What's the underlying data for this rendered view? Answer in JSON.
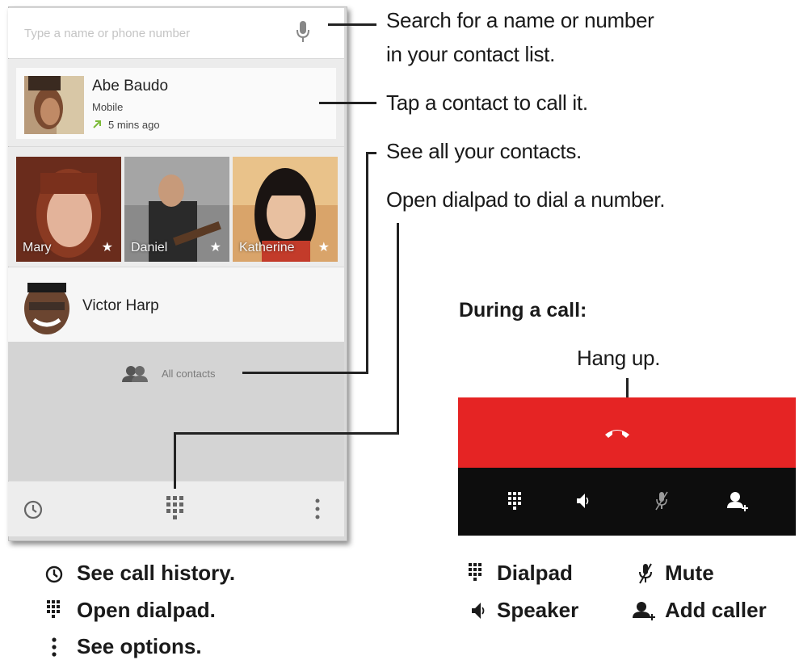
{
  "search": {
    "placeholder": "Type a name or phone number",
    "mic_icon": "microphone-icon"
  },
  "recent": {
    "name": "Abe Baudo",
    "type": "Mobile",
    "time": "5 mins ago",
    "arrow_icon": "outgoing-call-arrow-icon",
    "arrow_color": "#7dbb3a"
  },
  "favorites": [
    {
      "name": "Mary"
    },
    {
      "name": "Daniel"
    },
    {
      "name": "Katherine"
    }
  ],
  "contact": {
    "name": "Victor Harp"
  },
  "all_contacts": {
    "label": "All contacts",
    "icon": "contacts-icon"
  },
  "bottom_bar": {
    "history_icon": "clock-icon",
    "dialpad_icon": "dialpad-icon",
    "options_icon": "overflow-menu-icon"
  },
  "callouts": {
    "search_line1": "Search for a name or number",
    "search_line2": "in your contact list.",
    "tap_contact": "Tap a contact to call it.",
    "see_all": "See all your contacts.",
    "open_dialpad": "Open dialpad to dial a number."
  },
  "during_call": {
    "heading": "During a call:",
    "hang_up": "Hang up.",
    "red_color": "#e52424"
  },
  "legend_phone": {
    "history": "See call history.",
    "dialpad": "Open dialpad.",
    "options": "See options."
  },
  "legend_call": {
    "dialpad": "Dialpad",
    "mute": "Mute",
    "speaker": "Speaker",
    "add_caller": "Add caller"
  }
}
